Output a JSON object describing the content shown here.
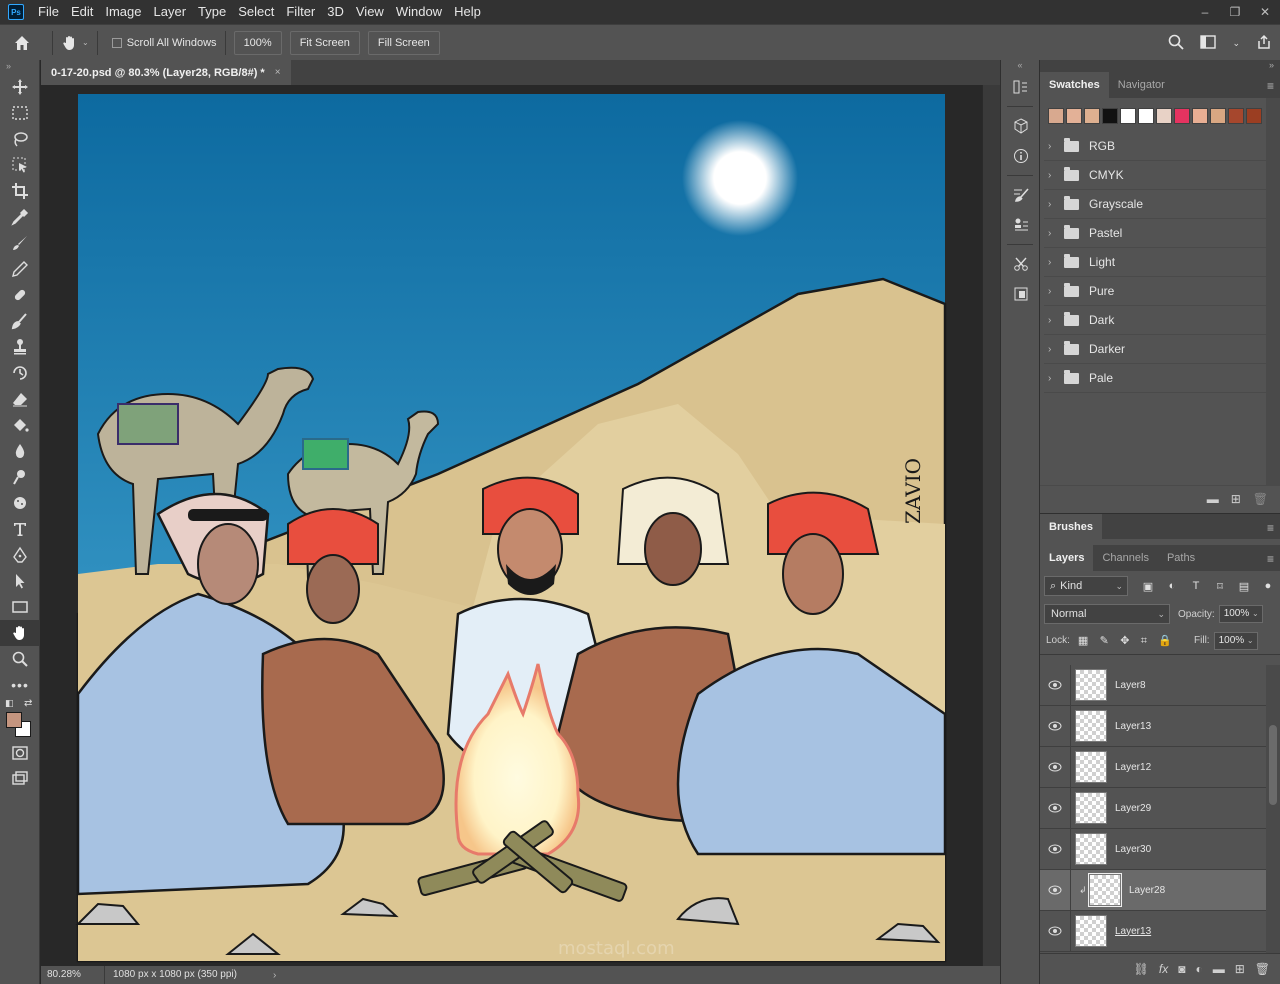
{
  "app": {
    "logo_text": "Ps",
    "menu": [
      "File",
      "Edit",
      "Image",
      "Layer",
      "Type",
      "Select",
      "Filter",
      "3D",
      "View",
      "Window",
      "Help"
    ],
    "window_controls": [
      "–",
      "❐",
      "✕"
    ]
  },
  "options_bar": {
    "scroll_all_windows_label": "Scroll All Windows",
    "scroll_all_windows_checked": false,
    "zoom_button": "100%",
    "fit_screen_button": "Fit Screen",
    "fill_screen_button": "Fill Screen"
  },
  "toolbar": {
    "tools": [
      "move",
      "marquee",
      "lasso",
      "object-select",
      "crop",
      "eyedropper",
      "healing-brush",
      "brush",
      "clone-stamp",
      "history-brush",
      "eraser",
      "paint-bucket",
      "blur",
      "dodge",
      "sponge",
      "type",
      "pen",
      "path-select",
      "rectangle",
      "hand",
      "zoom",
      "more"
    ],
    "active_tool": "hand",
    "foreground_color": "#c4957f",
    "background_color": "#ffffff"
  },
  "document": {
    "tab_title": "0-17-20.psd @ 80.3% (Layer28, RGB/8#) *",
    "tab_close": "×",
    "status_zoom": "80.28%",
    "status_info": "1080 px x 1080 px (350 ppi)",
    "status_arrow": "›",
    "signature_text": "ZAVIO",
    "watermark_text": "mostaql.com"
  },
  "swatches_panel": {
    "tabs": [
      "Swatches",
      "Navigator"
    ],
    "active_tab": "Swatches",
    "recent_colors": [
      "#d8a98f",
      "#e3b197",
      "#deb090",
      "#111111",
      "#ffffff",
      "#ffffff",
      "#e8d2c6",
      "#e53360",
      "#e8ae93",
      "#d9a782",
      "#a6472d",
      "#9b3e22"
    ],
    "groups": [
      "RGB",
      "CMYK",
      "Grayscale",
      "Pastel",
      "Light",
      "Pure",
      "Dark",
      "Darker",
      "Pale"
    ]
  },
  "brushes_panel": {
    "title": "Brushes"
  },
  "layers_panel": {
    "tabs": [
      "Layers",
      "Channels",
      "Paths"
    ],
    "active_tab": "Layers",
    "kind_filter": "Kind",
    "blend_mode": "Normal",
    "opacity_label": "Opacity:",
    "opacity_value": "100%",
    "lock_label": "Lock:",
    "fill_label": "Fill:",
    "fill_value": "100%",
    "layers": [
      {
        "name": "Layer8",
        "selected": false
      },
      {
        "name": "Layer13",
        "selected": false
      },
      {
        "name": "Layer12",
        "selected": false
      },
      {
        "name": "Layer29",
        "selected": false
      },
      {
        "name": "Layer30",
        "selected": false
      },
      {
        "name": "Layer28",
        "selected": true,
        "clipped": true
      },
      {
        "name": "Layer13",
        "selected": false
      }
    ]
  },
  "colors": {
    "chrome_dark": "#323232",
    "chrome_mid": "#535353",
    "sky_top": "#0d6aa0",
    "sky_bottom": "#5fb4d4",
    "sand": "#d9c28f"
  }
}
